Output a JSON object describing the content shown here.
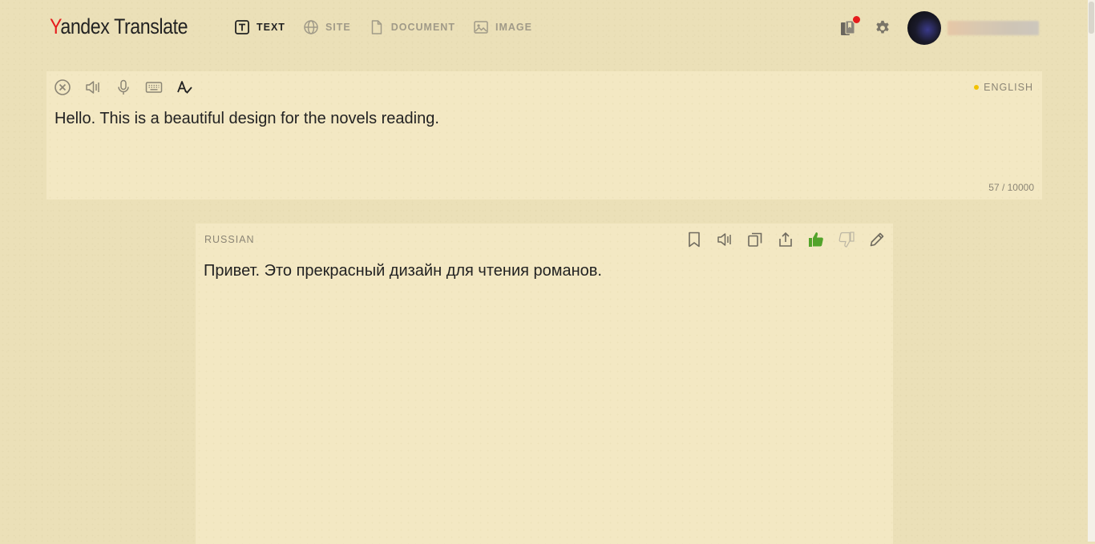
{
  "app": {
    "logo_brand_first": "Y",
    "logo_brand_rest": "andex",
    "logo_product": " Translate"
  },
  "nav": {
    "items": [
      {
        "label": "TEXT",
        "icon": "text-icon",
        "active": true
      },
      {
        "label": "SITE",
        "icon": "globe-icon",
        "active": false
      },
      {
        "label": "DOCUMENT",
        "icon": "document-icon",
        "active": false
      },
      {
        "label": "IMAGE",
        "icon": "image-icon",
        "active": false
      }
    ]
  },
  "header": {
    "has_notification": true
  },
  "source": {
    "language": "ENGLISH",
    "text": "Hello. This is a beautiful design for the novels reading.",
    "counter": "57 / 10000"
  },
  "target": {
    "language": "RUSSIAN",
    "text": "Привет. Это прекрасный дизайн для чтения романов.",
    "thumbs_up_active": true
  },
  "colors": {
    "background": "#ebe0b8",
    "panel": "#f3e8c3",
    "brand_red": "#e51c1c",
    "thumb_green": "#52a32a",
    "language_dot": "#f2c200"
  }
}
